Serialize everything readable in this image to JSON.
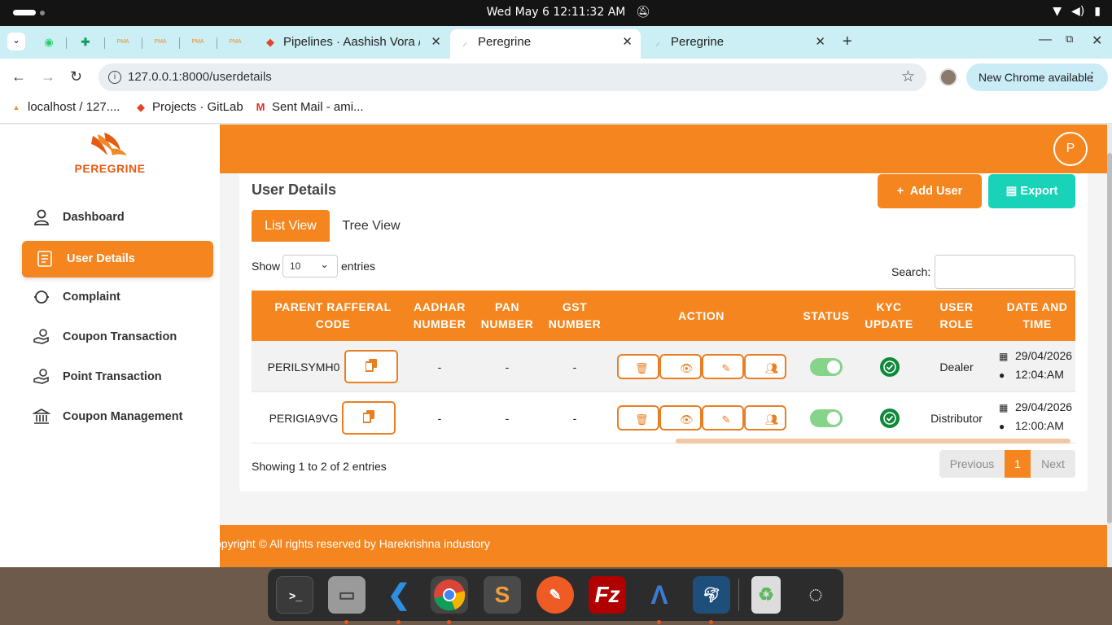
{
  "os": {
    "clock": "Wed May 6  12:11:32 AM"
  },
  "browser": {
    "tabs": [
      {
        "label": "Pipelines · Aashish Vora /",
        "active": false
      },
      {
        "label": "Peregrine",
        "active": true
      },
      {
        "label": "Peregrine",
        "active": false
      }
    ],
    "pinned_tab_labels": [
      "PMA",
      "PMA",
      "PMA",
      "PMA"
    ],
    "url": "127.0.0.1:8000/userdetails",
    "update_button": "New Chrome available",
    "bookmarks": [
      {
        "label": "localhost / 127...."
      },
      {
        "label": "Projects · GitLab"
      },
      {
        "label": "Sent Mail - ami..."
      }
    ]
  },
  "app": {
    "brand": "PEREGRINE",
    "avatar_initial": "P",
    "sidebar": {
      "items": [
        {
          "label": "Dashboard",
          "icon": "user-icon",
          "active": false
        },
        {
          "label": "User Details",
          "icon": "list-icon",
          "active": true
        },
        {
          "label": "Complaint",
          "icon": "complaint-icon",
          "active": false
        },
        {
          "label": "Coupon Transaction",
          "icon": "hand-coin-icon",
          "active": false
        },
        {
          "label": "Point Transaction",
          "icon": "hand-coin-icon",
          "active": false
        },
        {
          "label": "Coupon Management",
          "icon": "bank-icon",
          "active": false
        }
      ]
    },
    "content": {
      "title": "User Details",
      "add_button": "Add User",
      "export_button": "Export",
      "view_tabs": [
        "List View",
        "Tree View"
      ],
      "show_label": "Show",
      "entries_label": "entries",
      "page_length": "10",
      "search_label": "Search:",
      "search_value": "",
      "columns": [
        "PARENT RAFFERAL CODE",
        "AADHAR NUMBER",
        "PAN NUMBER",
        "GST NUMBER",
        "ACTION",
        "STATUS",
        "KYC UPDATE",
        "USER ROLE",
        "DATE AND TIME"
      ],
      "rows": [
        {
          "code": "PERILSYMH0",
          "aadhar": "-",
          "pan": "-",
          "gst": "-",
          "status": true,
          "kyc": true,
          "role": "Dealer",
          "date": "29/04/2026",
          "time": "12:04:AM"
        },
        {
          "code": "PERIGIA9VG",
          "aadhar": "-",
          "pan": "-",
          "gst": "-",
          "status": true,
          "kyc": true,
          "role": "Distributor",
          "date": "29/04/2026",
          "time": "12:00:AM"
        }
      ],
      "showing_text": "Showing 1 to 2 of 2 entries",
      "pagination": {
        "previous": "Previous",
        "current": "1",
        "next": "Next"
      }
    },
    "footer": "opyright © All rights reserved by Harekrishna industory"
  },
  "colors": {
    "accent": "#f5861f",
    "export": "#19d3b8",
    "toggle_on": "#86d38a",
    "kyc_ok": "#0d8a3a"
  }
}
